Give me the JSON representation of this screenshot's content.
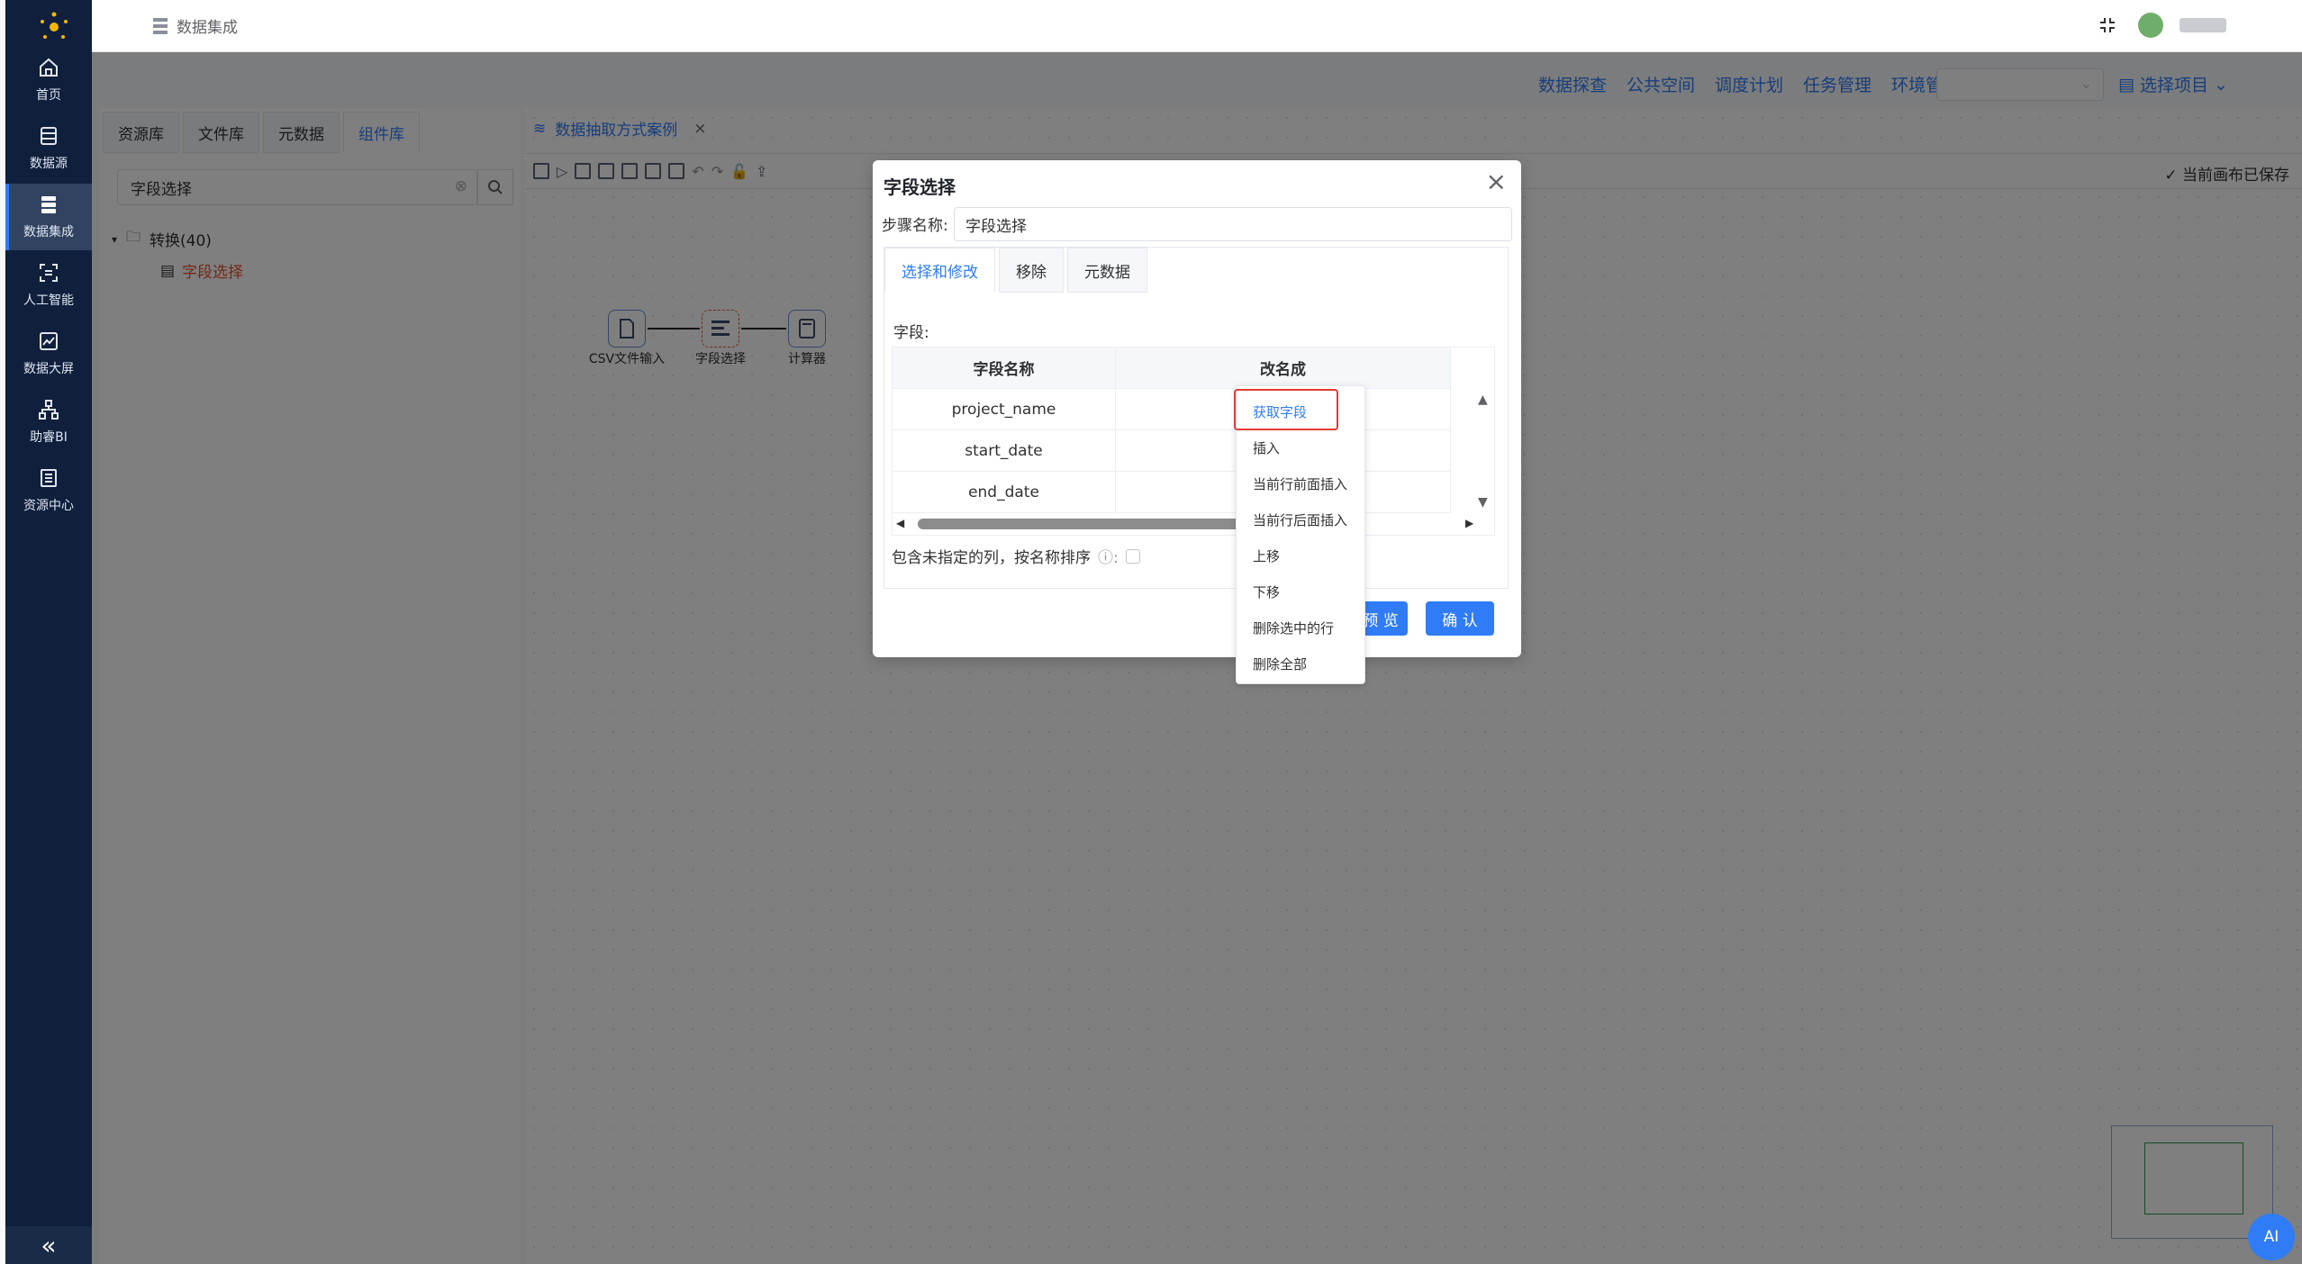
{
  "sidebar": {
    "items": [
      {
        "label": "首页",
        "icon": "home-icon"
      },
      {
        "label": "数据源",
        "icon": "database-icon"
      },
      {
        "label": "数据集成",
        "icon": "layers-icon"
      },
      {
        "label": "人工智能",
        "icon": "ai-icon"
      },
      {
        "label": "数据大屏",
        "icon": "chart-icon"
      },
      {
        "label": "助睿BI",
        "icon": "org-icon"
      },
      {
        "label": "资源中心",
        "icon": "resource-icon"
      }
    ],
    "collapse": "«"
  },
  "topbar": {
    "breadcrumb": "数据集成"
  },
  "subnav": {
    "items": [
      "数据探查",
      "公共空间",
      "调度计划",
      "任务管理",
      "环境管理"
    ],
    "project_button": "选择项目"
  },
  "left_panel": {
    "tabs": [
      "资源库",
      "文件库",
      "元数据",
      "组件库"
    ],
    "search_value": "字段选择",
    "tree_folder": "转换(40)",
    "tree_item": "字段选择"
  },
  "canvas": {
    "tab_label": "数据抽取方式案例",
    "saved_status": "当前画布已保存",
    "nodes": [
      "CSV文件输入",
      "字段选择",
      "计算器"
    ]
  },
  "dialog": {
    "title": "字段选择",
    "step_label": "步骤名称:",
    "step_value": "字段选择",
    "tabs": [
      "选择和修改",
      "移除",
      "元数据"
    ],
    "fields_label": "字段:",
    "columns": [
      "字段名称",
      "改名成"
    ],
    "rows": [
      "project_name",
      "start_date",
      "end_date"
    ],
    "include_label": "包含未指定的列，按名称排序",
    "preview_button": "预 览",
    "confirm_button": "确 认"
  },
  "context_menu": {
    "items": [
      "获取字段",
      "插入",
      "当前行前面插入",
      "当前行后面插入",
      "上移",
      "下移",
      "删除选中的行",
      "删除全部"
    ]
  },
  "ai_button": "AI",
  "colors": {
    "accent": "#2f7cf6",
    "sidebar": "#0f1f3c",
    "highlight": "#e53935"
  }
}
